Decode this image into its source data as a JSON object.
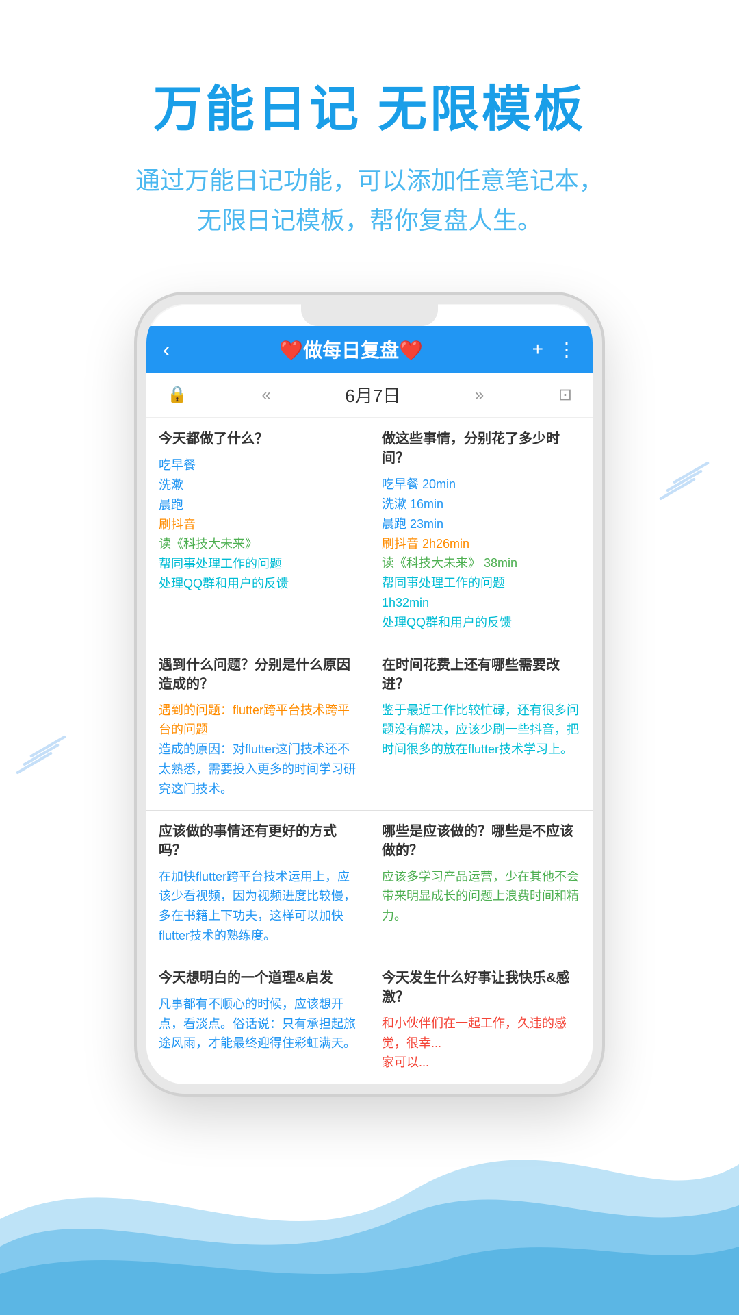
{
  "hero": {
    "title": "万能日记  无限模板",
    "subtitle_line1": "通过万能日记功能，可以添加任意笔记本，",
    "subtitle_line2": "无限日记模板，帮你复盘人生。"
  },
  "app": {
    "header": {
      "back_icon": "‹",
      "title": "❤️做每日复盘❤️",
      "add_icon": "+",
      "more_icon": "⋮"
    },
    "date_nav": {
      "lock_icon": "🔒",
      "prev_icon": "«",
      "date": "6月7日",
      "next_icon": "»",
      "expand_icon": "⊡"
    },
    "grid": [
      {
        "id": "cell-1",
        "header": "今天都做了什么？",
        "header_color": "dark",
        "lines": [
          {
            "text": "吃早餐",
            "color": "blue"
          },
          {
            "text": "洗漱",
            "color": "blue"
          },
          {
            "text": "晨跑",
            "color": "blue"
          },
          {
            "text": "刷抖音",
            "color": "orange"
          },
          {
            "text": "读《科技大未来》",
            "color": "green"
          },
          {
            "text": "帮同事处理工作的问题",
            "color": "teal"
          },
          {
            "text": "处理QQ群和用户的反馈",
            "color": "teal"
          }
        ]
      },
      {
        "id": "cell-2",
        "header": "做这些事情，分别花了多少时间？",
        "header_color": "dark",
        "lines": [
          {
            "text": "吃早餐 20min",
            "color": "blue"
          },
          {
            "text": "洗漱 16min",
            "color": "blue"
          },
          {
            "text": "晨跑 23min",
            "color": "blue"
          },
          {
            "text": "刷抖音 2h26min",
            "color": "orange"
          },
          {
            "text": "读《科技大未来》 38min",
            "color": "green"
          },
          {
            "text": "帮同事处理工作的问题",
            "color": "teal"
          },
          {
            "text": "1h32min",
            "color": "teal"
          },
          {
            "text": "处理QQ群和用户的反馈",
            "color": "teal"
          }
        ]
      },
      {
        "id": "cell-3",
        "header": "遇到什么问题？分别是什么原因造成的？",
        "header_color": "dark",
        "lines": [
          {
            "text": "遇到的问题：flutter跨平台技术跨平台的问题",
            "color": "orange"
          },
          {
            "text": "造成的原因：对flutter这门技术还不太熟悉，需要投入更多的时间学习研究这门技术。",
            "color": "blue"
          }
        ]
      },
      {
        "id": "cell-4",
        "header": "在时间花费上还有哪些需要改进？",
        "header_color": "dark",
        "lines": [
          {
            "text": "鉴于最近工作比较忙碌，还有很多问题没有解决，应该少刷一些抖音，把时间很多的放在flutter技术学习上。",
            "color": "teal"
          }
        ]
      },
      {
        "id": "cell-5",
        "header": "应该做的事情还有更好的方式吗？",
        "header_color": "dark",
        "lines": [
          {
            "text": "在加快flutter跨平台技术运用上，应该少看视频，因为视频进度比较慢，多在书籍上下功夫，这样可以加快flutter技术的熟练度。",
            "color": "blue"
          }
        ]
      },
      {
        "id": "cell-6",
        "header": "哪些是应该做的？哪些是不应该做的？",
        "header_color": "dark",
        "lines": [
          {
            "text": "应该多学习产品运营，少在其他不会带来明显成长的问题上浪费时间和精力。",
            "color": "green"
          }
        ]
      },
      {
        "id": "cell-7",
        "header": "今天想明白的一个道理&启发",
        "header_color": "dark",
        "lines": [
          {
            "text": "凡事都有不顺心的时候，应该想开点，看淡点。俗话说：只有承担起旅途风雨，才能最终迎得住彩虹满天。",
            "color": "blue"
          }
        ]
      },
      {
        "id": "cell-8",
        "header": "今天发生什么好事让我快乐&感激？",
        "header_color": "dark",
        "lines": [
          {
            "text": "和小伙伴们在一起工作，久违的感觉，很幸...",
            "color": "red"
          },
          {
            "text": "家可以...",
            "color": "red"
          }
        ]
      }
    ]
  },
  "decorations": {
    "wave_color": "#a8d4f5",
    "line_color": "#c5dff8"
  }
}
